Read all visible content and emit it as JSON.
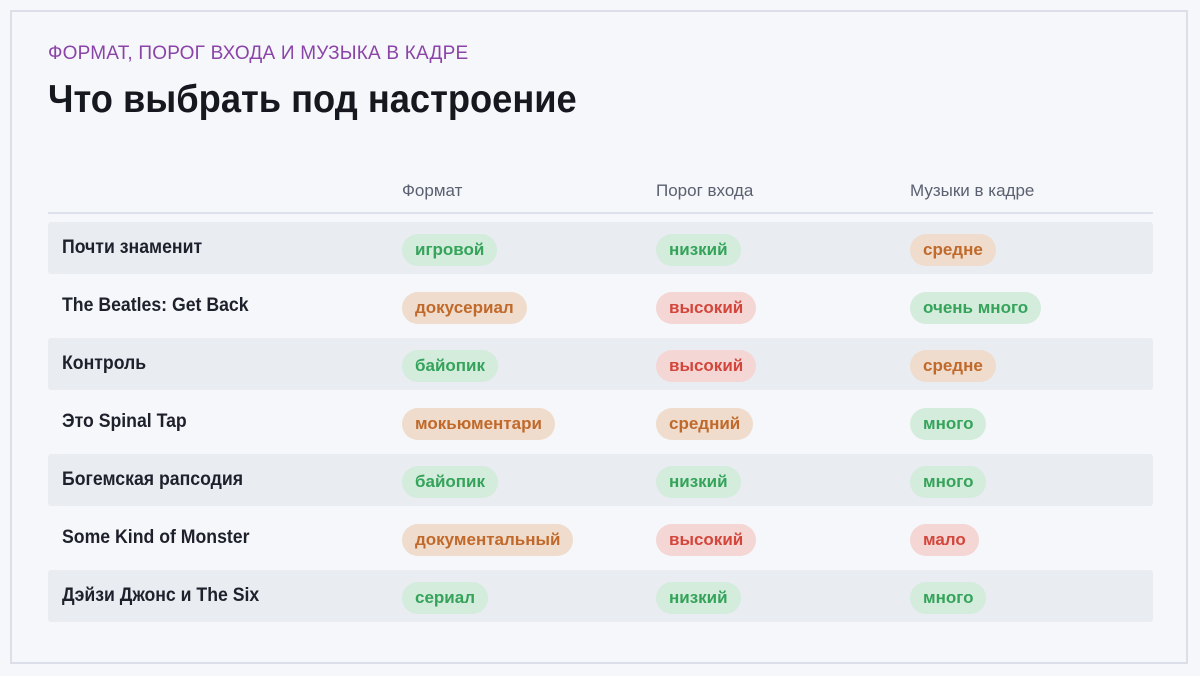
{
  "header": {
    "eyebrow": "ФОРМАТ, ПОРОГ ВХОДА И МУЗЫКА В КАДРЕ",
    "title": "Что выбрать под настроение"
  },
  "table": {
    "columns": [
      "Формат",
      "Порог входа",
      "Музыки в кадре"
    ],
    "rows": [
      {
        "name": "Почти знаменит",
        "format": "игровой",
        "format_tone": "green",
        "entry": "низкий",
        "entry_tone": "green",
        "music": "средне",
        "music_tone": "orange"
      },
      {
        "name": "The Beatles: Get Back",
        "format": "докусериал",
        "format_tone": "orange",
        "entry": "высокий",
        "entry_tone": "red",
        "music": "очень много",
        "music_tone": "green"
      },
      {
        "name": "Контроль",
        "format": "байопик",
        "format_tone": "green",
        "entry": "высокий",
        "entry_tone": "red",
        "music": "средне",
        "music_tone": "orange"
      },
      {
        "name": "Это Spinal Tap",
        "format": "мокьюментари",
        "format_tone": "orange",
        "entry": "средний",
        "entry_tone": "orange",
        "music": "много",
        "music_tone": "green"
      },
      {
        "name": "Богемская рапсодия",
        "format": "байопик",
        "format_tone": "green",
        "entry": "низкий",
        "entry_tone": "green",
        "music": "много",
        "music_tone": "green"
      },
      {
        "name": "Some Kind of Monster",
        "format": "документальный",
        "format_tone": "orange",
        "entry": "высокий",
        "entry_tone": "red",
        "music": "мало",
        "music_tone": "red"
      },
      {
        "name": "Дэйзи Джонс и The Six",
        "format": "сериал",
        "format_tone": "green",
        "entry": "низкий",
        "entry_tone": "green",
        "music": "много",
        "music_tone": "green"
      }
    ]
  },
  "colors": {
    "accent": "#8a44a8",
    "green": "#35a35a",
    "orange": "#c0692a",
    "red": "#d2463c"
  }
}
